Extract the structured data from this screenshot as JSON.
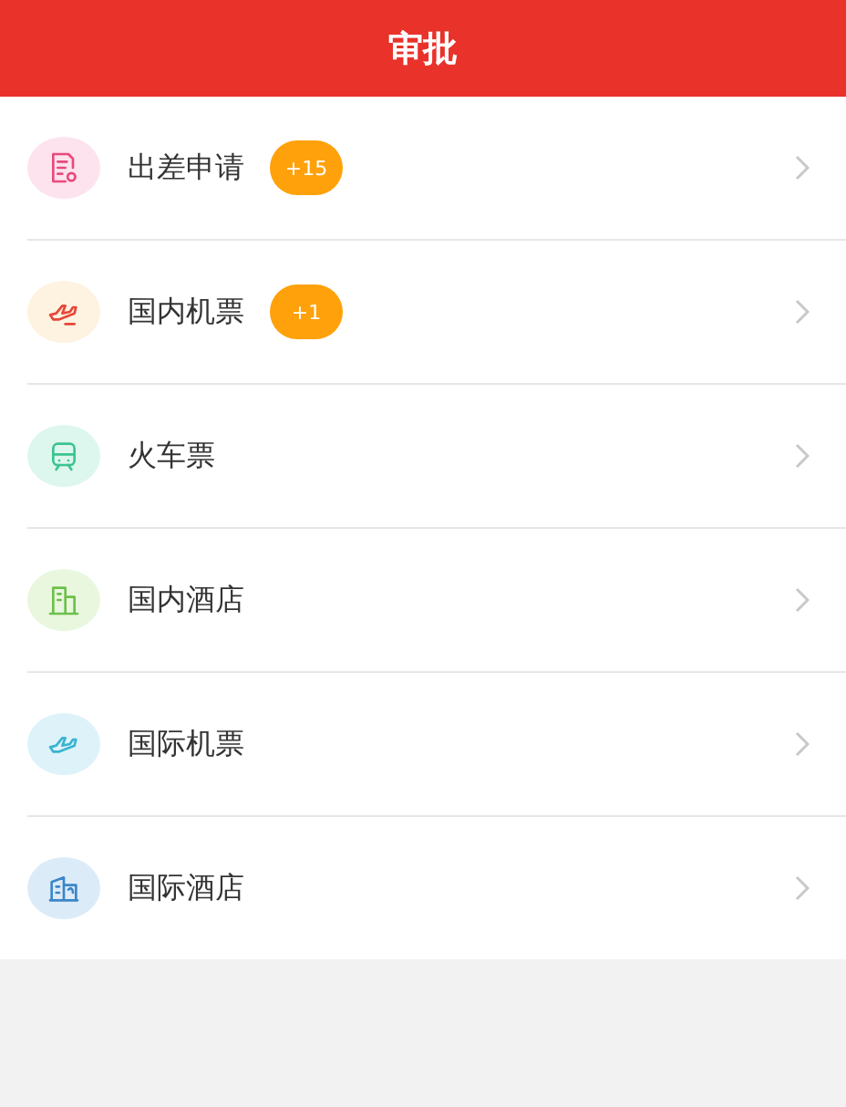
{
  "header": {
    "title": "审批"
  },
  "items": [
    {
      "label": "出差申请",
      "kind": "trip",
      "badge": "+15"
    },
    {
      "label": "国内机票",
      "kind": "domestic-flight",
      "badge": "+1"
    },
    {
      "label": "火车票",
      "kind": "train"
    },
    {
      "label": "国内酒店",
      "kind": "domestic-hotel"
    },
    {
      "label": "国际机票",
      "kind": "intl-flight"
    },
    {
      "label": "国际酒店",
      "kind": "intl-hotel"
    }
  ]
}
